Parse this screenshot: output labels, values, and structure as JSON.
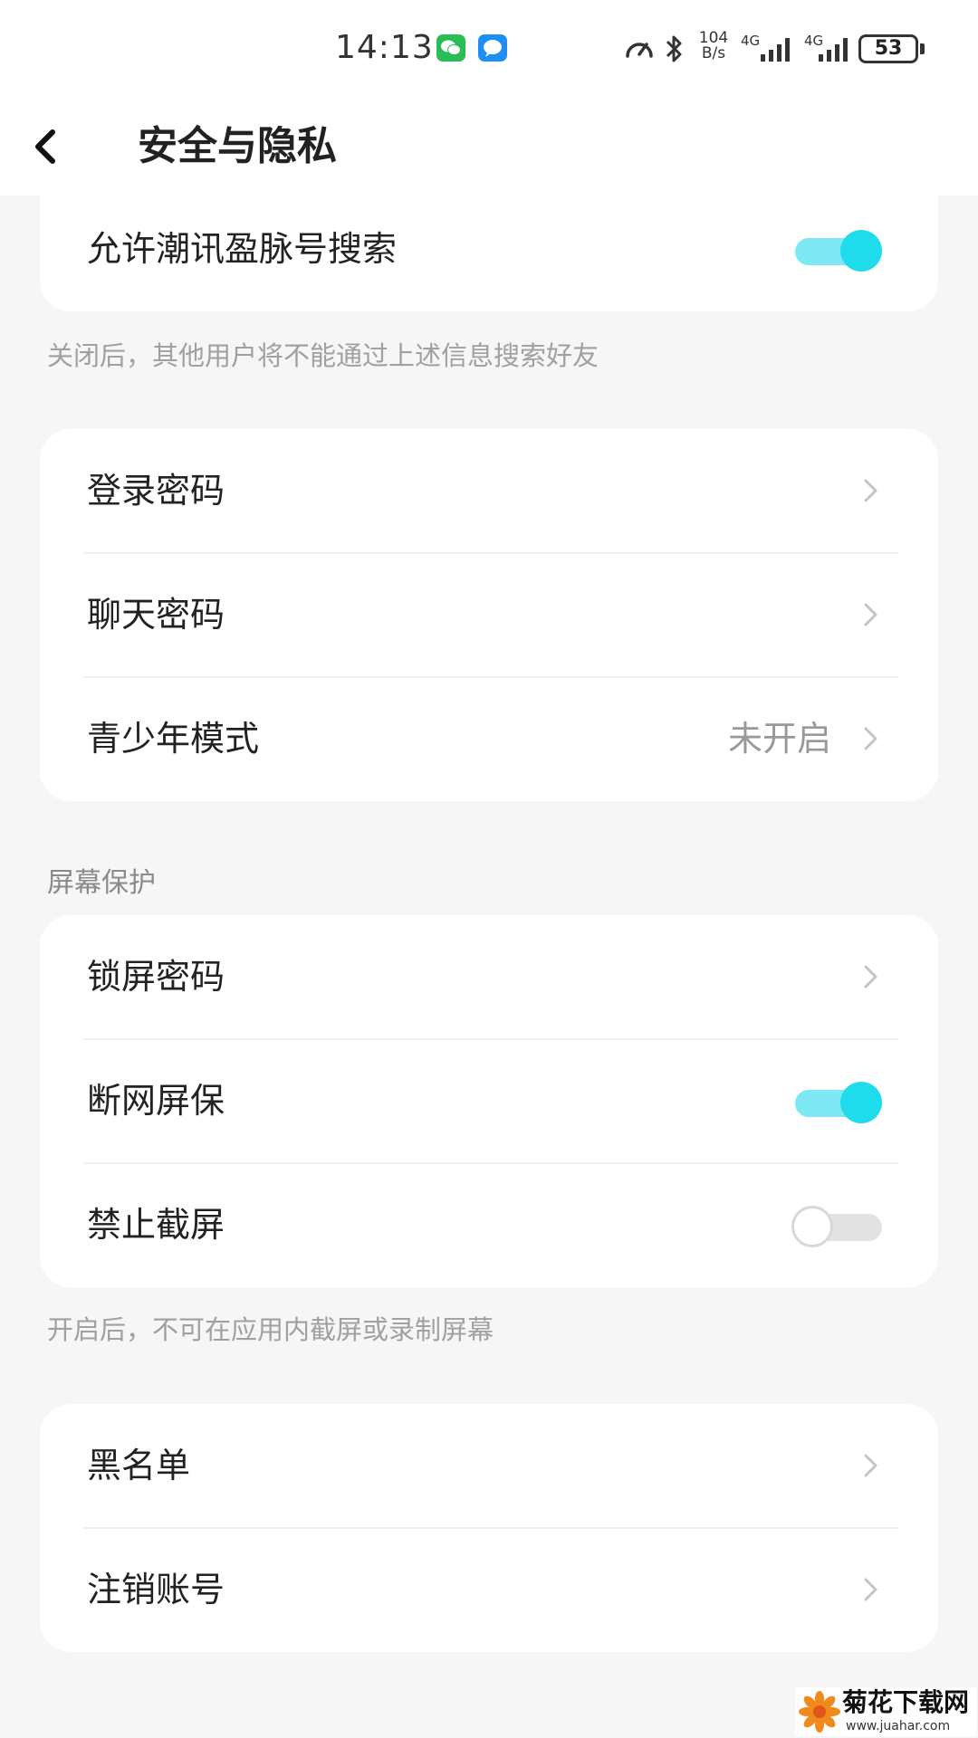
{
  "status_bar": {
    "time": "14:13",
    "net_speed_value": "104",
    "net_speed_unit": "B/s",
    "network_1": "4G",
    "network_2": "4G",
    "battery": "53"
  },
  "header": {
    "title": "安全与隐私"
  },
  "search_card": {
    "label": "允许潮讯盈脉号搜索",
    "toggle_on": true
  },
  "search_hint": "关闭后，其他用户将不能通过上述信息搜索好友",
  "password_card": {
    "items": [
      {
        "label": "登录密码"
      },
      {
        "label": "聊天密码"
      },
      {
        "label": "青少年模式",
        "value": "未开启"
      }
    ]
  },
  "screen_section": {
    "title": "屏幕保护",
    "items": [
      {
        "label": "锁屏密码"
      },
      {
        "label": "断网屏保",
        "toggle_on": true
      },
      {
        "label": "禁止截屏",
        "toggle_on": false
      }
    ],
    "hint": "开启后，不可在应用内截屏或录制屏幕"
  },
  "account_card": {
    "items": [
      {
        "label": "黑名单"
      },
      {
        "label": "注销账号"
      }
    ]
  },
  "watermark": {
    "title": "菊花下载网",
    "url": "www.juahar.com"
  },
  "colors": {
    "toggle_on_track": "#7ee9f4",
    "toggle_on_knob": "#1fdcec",
    "background": "#f6f6f6"
  }
}
